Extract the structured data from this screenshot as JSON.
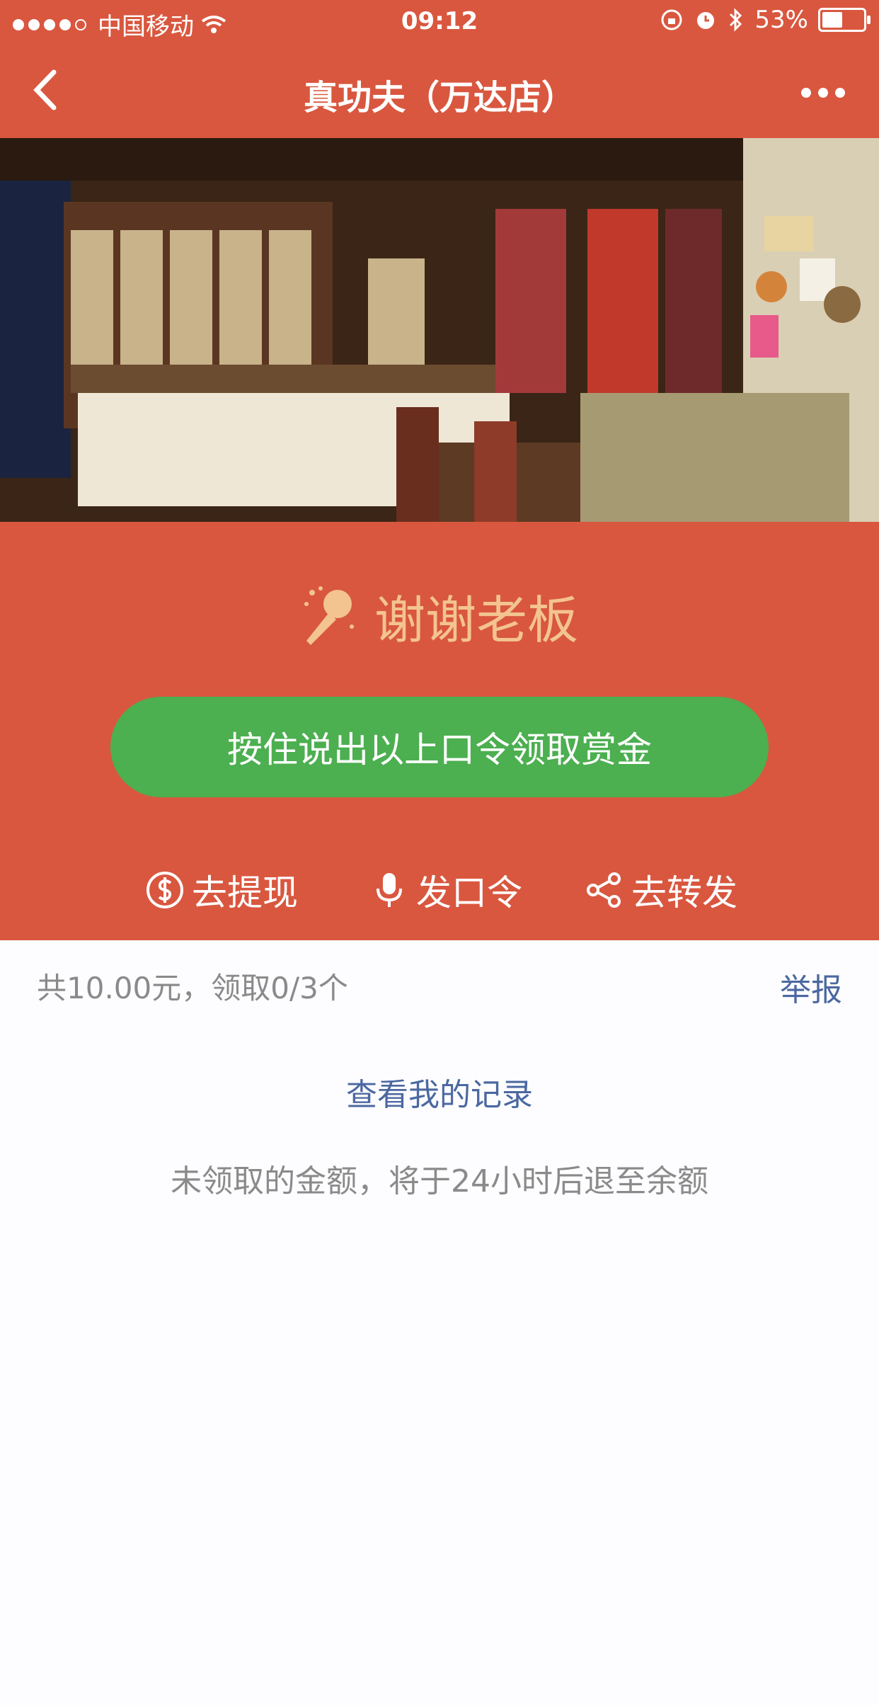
{
  "status_bar": {
    "carrier": "中国移动",
    "time": "09:12",
    "battery": "53%"
  },
  "nav": {
    "title": "真功夫（万达店）"
  },
  "colors": {
    "primary": "#d9573f",
    "button": "#4caf50",
    "phrase": "#f3c48f",
    "link": "#4b68a0",
    "muted": "#8a8a8a"
  },
  "passphrase": "谢谢老板",
  "hold_button": "按住说出以上口令领取赏金",
  "actions": [
    {
      "label": "去提现",
      "icon": "dollar-icon"
    },
    {
      "label": "发口令",
      "icon": "microphone-icon"
    },
    {
      "label": "去转发",
      "icon": "share-icon"
    }
  ],
  "summary": "共10.00元，领取0/3个",
  "report": "举报",
  "records_link": "查看我的记录",
  "notice": "未领取的金额，将于24小时后退至余额"
}
